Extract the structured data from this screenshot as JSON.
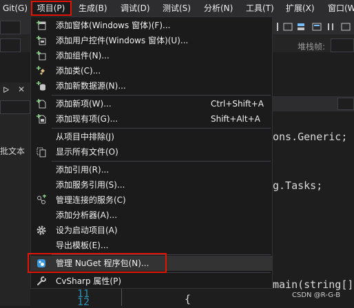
{
  "menubar": {
    "items": [
      "Git(G)",
      "项目(P)",
      "生成(B)",
      "调试(D)",
      "测试(S)",
      "分析(N)",
      "工具(T)",
      "扩展(X)",
      "窗口(W"
    ]
  },
  "background": {
    "stack_frame_label": "堆栈帧:",
    "left_text": "批文本",
    "code_lines": [
      "ons.Generic;",
      "g.Tasks;",
      "main(string[]",
      "{"
    ],
    "line_numbers": [
      "11",
      "12"
    ],
    "watermark": "CSDN @R-G-B"
  },
  "project_menu": {
    "items": [
      {
        "label": "添加窗体(Windows 窗体)(F)...",
        "icon": "add-form-icon"
      },
      {
        "label": "添加用户控件(Windows 窗体)(U)...",
        "icon": "add-user-control-icon"
      },
      {
        "label": "添加组件(N)...",
        "icon": "add-component-icon"
      },
      {
        "label": "添加类(C)...",
        "icon": "add-class-icon"
      },
      {
        "label": "添加新数据源(N)...",
        "icon": "add-data-source-icon"
      },
      {
        "label": "添加新项(W)...",
        "shortcut": "Ctrl+Shift+A",
        "icon": "add-new-item-icon"
      },
      {
        "label": "添加现有项(G)...",
        "shortcut": "Shift+Alt+A",
        "icon": "add-existing-item-icon"
      },
      {
        "label": "从项目中排除(J)"
      },
      {
        "label": "显示所有文件(O)",
        "icon": "show-all-files-icon"
      },
      {
        "label": "添加引用(R)..."
      },
      {
        "label": "添加服务引用(S)..."
      },
      {
        "label": "管理连接的服务(C)",
        "icon": "connected-services-icon"
      },
      {
        "label": "添加分析器(A)..."
      },
      {
        "label": "设为启动项目(A)",
        "icon": "gear-icon"
      },
      {
        "label": "导出模板(E)..."
      },
      {
        "label": "管理 NuGet 程序包(N)...",
        "icon": "nuget-icon"
      },
      {
        "label": "CvSharp 属性(P)",
        "icon": "wrench-icon"
      }
    ]
  },
  "colors": {
    "accent_green": "#89d185",
    "annotation_red": "#e51400",
    "nuget_blue": "#3a96dd"
  }
}
